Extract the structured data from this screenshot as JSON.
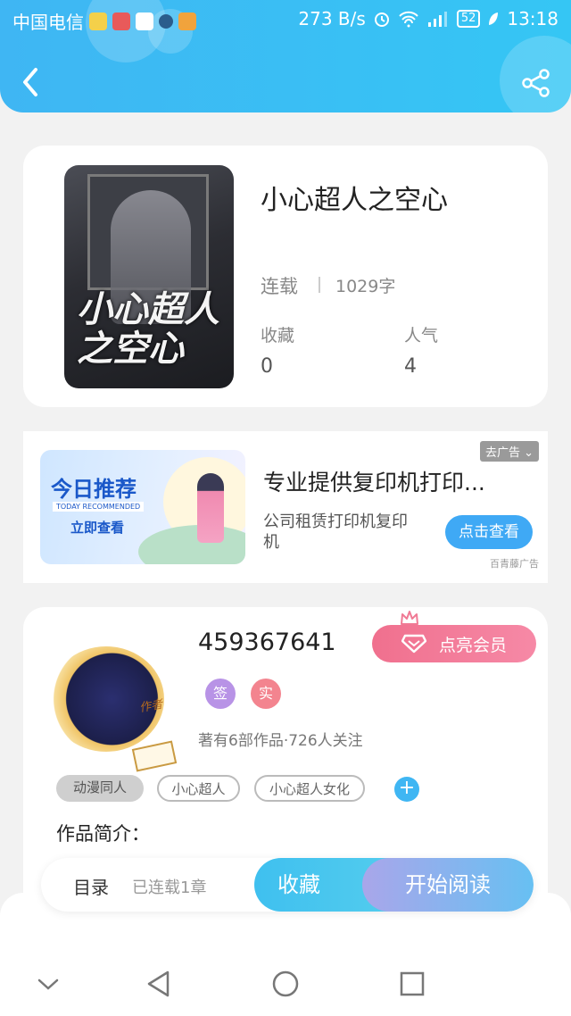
{
  "status_bar": {
    "carrier": "中国电信",
    "speed": "273 B/s",
    "battery": "52",
    "time": "13:18"
  },
  "book": {
    "title": "小心超人之空心",
    "cover_title": "小心超人之空心",
    "status": "连载",
    "word_count": "1029字",
    "stats": [
      {
        "label": "收藏",
        "value": "0"
      },
      {
        "label": "人气",
        "value": "4"
      }
    ]
  },
  "ad": {
    "image_title": "今日推荐",
    "image_subtitle": "TODAY RECOMMENDED",
    "image_cta": "立即查看",
    "close_label": "去广告",
    "headline": "专业提供复印机打印...",
    "description": "公司租赁打印机复印机",
    "button": "点击查看",
    "source": "百青藤广告"
  },
  "author": {
    "name": "459367641",
    "avatar_tag": "作者",
    "vip_button": "点亮会员",
    "badges": [
      {
        "label": "签",
        "color": "#b893e6"
      },
      {
        "label": "实",
        "color": "#f3848f"
      }
    ],
    "meta": "著有6部作品·726人关注",
    "tags": [
      "动漫同人",
      "小心超人",
      "小心超人女化"
    ],
    "add_tag": "+",
    "intro_label": "作品简介："
  },
  "actions": {
    "catalog": "目录",
    "chapters": "已连载1章",
    "collect": "收藏",
    "read": "开始阅读"
  },
  "colors": {
    "header": "#3fb6f3",
    "accent_blue": "#3fa9f5",
    "vip_pink": "#f0708e"
  },
  "icons": [
    "back-icon",
    "share-icon",
    "crown-icon",
    "diamond-icon",
    "nav-down-icon",
    "nav-back-icon",
    "nav-home-icon",
    "nav-recent-icon"
  ]
}
